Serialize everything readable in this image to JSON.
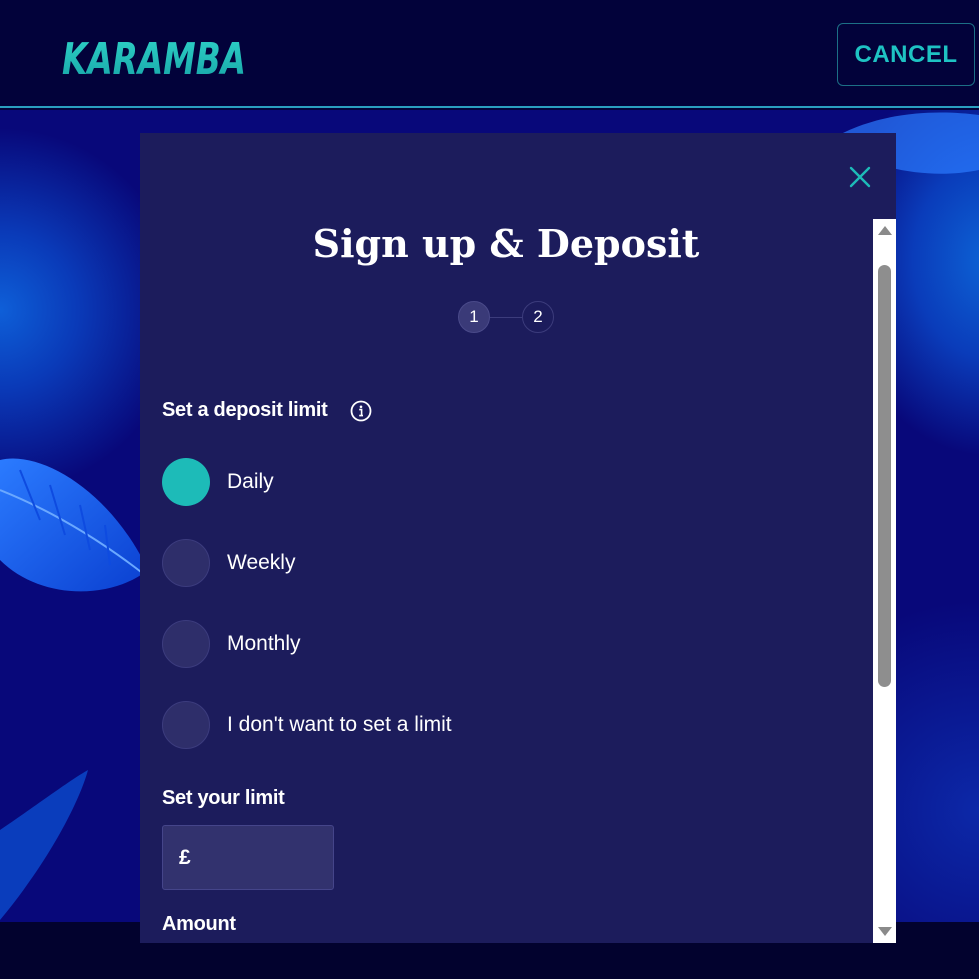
{
  "header": {
    "logo_text": "KARAMBA",
    "cancel_label": "CANCEL"
  },
  "modal": {
    "title": "Sign up & Deposit",
    "steps": [
      "1",
      "2"
    ],
    "current_step": 1,
    "deposit_limit_label": "Set a deposit limit",
    "limit_options": [
      {
        "label": "Daily",
        "selected": true
      },
      {
        "label": "Weekly",
        "selected": false
      },
      {
        "label": "Monthly",
        "selected": false
      },
      {
        "label": "I don't want to set a limit",
        "selected": false
      }
    ],
    "your_limit_label": "Set your limit",
    "currency_symbol": "£",
    "limit_value": "",
    "amount_label": "Amount"
  },
  "colors": {
    "accent": "#1dbbb8",
    "modal_bg": "#1c1c5c",
    "header_bg": "#02023a"
  },
  "icons": [
    "close-icon",
    "info-icon",
    "feather-icon"
  ]
}
